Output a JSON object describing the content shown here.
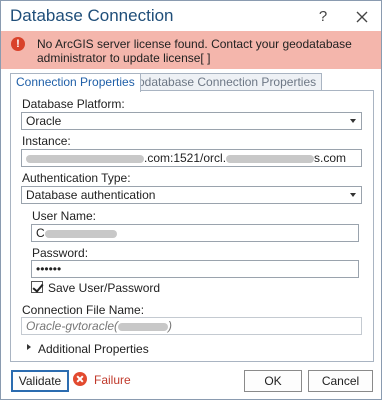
{
  "window": {
    "title": "Database Connection",
    "help_glyph": "?",
    "close_icon": "close-icon"
  },
  "alert": {
    "icon": "exclamation-icon",
    "icon_glyph": "!",
    "message": "No ArcGIS server license found. Contact your geodatabase administrator to update license[ ]"
  },
  "tabs": [
    {
      "label": "Connection Properties",
      "active": true
    },
    {
      "label": "Geodatabase Connection Properties",
      "active": false
    }
  ],
  "form": {
    "platform_label": "Database Platform:",
    "platform_value": "Oracle",
    "instance_label": "Instance:",
    "instance_value_visible_middle": ".com:1521/orcl.",
    "instance_value_visible_end": "s.com",
    "auth_type_label": "Authentication Type:",
    "auth_type_value": "Database authentication",
    "username_label": "User Name:",
    "username_value_visible": "C",
    "password_label": "Password:",
    "password_value": "••••••",
    "save_label": "Save User/Password",
    "save_checked": true,
    "conn_file_label": "Connection File Name:",
    "conn_file_value": "Oracle-gvtoracle(",
    "conn_file_suffix": ")",
    "additional_label": "Additional Properties"
  },
  "footer": {
    "validate_label": "Validate",
    "status_icon": "error-x-icon",
    "status_text": "Failure",
    "ok_label": "OK",
    "cancel_label": "Cancel"
  },
  "colors": {
    "title": "#1f4e79",
    "alert_bg": "#f4b6ac",
    "failure": "#c0392b",
    "active_tab_text": "#1f5fa8"
  }
}
